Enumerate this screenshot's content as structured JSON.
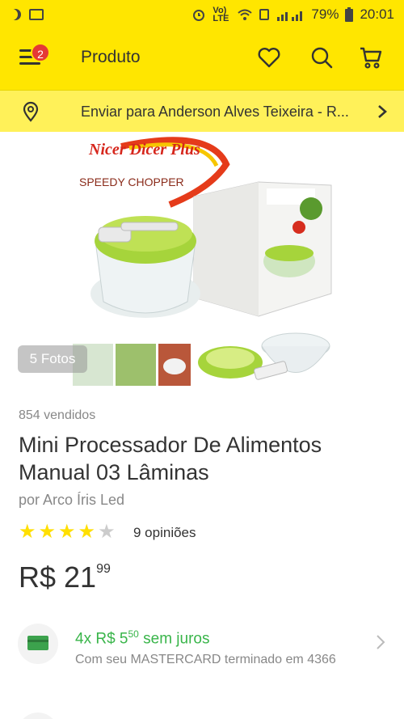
{
  "status_bar": {
    "volte": "Vo) LTE",
    "battery": "79%",
    "time": "20:01"
  },
  "app_bar": {
    "menu_badge": "2",
    "title": "Produto"
  },
  "address_bar": {
    "text": "Enviar para Anderson Alves Teixeira - R..."
  },
  "gallery": {
    "photos_label": "5 Fotos",
    "product_logo_text": "Nicer Dicer Plus",
    "product_tagline": "SPEEDY CHOPPER"
  },
  "product": {
    "sold_count": "854 vendidos",
    "title": "Mini Processador De Alimentos Manual 03 Lâminas",
    "seller": "por Arco Íris Led",
    "rating_stars": 4,
    "reviews": "9 opiniões",
    "price_main": "R$ 21",
    "price_cents": "99"
  },
  "installments": {
    "prefix": "4x R$ 5",
    "cents": "50",
    "suffix": " sem juros",
    "detail": "Com seu MASTERCARD terminado em 4366"
  },
  "colors": {
    "brand_yellow": "#ffe600",
    "installment_green": "#39b54a",
    "star_yellow": "#ffdf00"
  }
}
